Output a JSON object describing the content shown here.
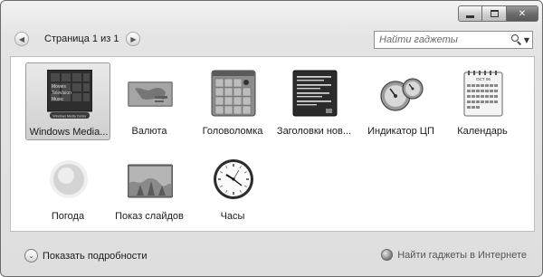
{
  "window": {
    "controls": {
      "minimize": "minimize",
      "maximize": "maximize",
      "close": "✕"
    }
  },
  "pager": {
    "prev": "◀",
    "text": "Страница 1 из 1",
    "next": "▶"
  },
  "search": {
    "placeholder": "Найти гаджеты",
    "dropdown": "▼"
  },
  "gadgets": [
    {
      "label": "Windows Media...",
      "icon": "media-center-icon",
      "selected": true,
      "thumb_lines": [
        "Movies",
        "Television",
        "Music"
      ],
      "thumb_caption": "Windows Media Center"
    },
    {
      "label": "Валюта",
      "icon": "currency-icon"
    },
    {
      "label": "Головоломка",
      "icon": "puzzle-icon"
    },
    {
      "label": "Заголовки нов...",
      "icon": "news-headlines-icon"
    },
    {
      "label": "Индикатор ЦП",
      "icon": "cpu-meter-icon"
    },
    {
      "label": "Календарь",
      "icon": "calendar-icon",
      "thumb_month": "OCT 06"
    },
    {
      "label": "Погода",
      "icon": "weather-icon"
    },
    {
      "label": "Показ слайдов",
      "icon": "slideshow-icon"
    },
    {
      "label": "Часы",
      "icon": "clock-icon"
    }
  ],
  "footer": {
    "details_chevron": "⌄",
    "details_label": "Показать подробности",
    "online_label": "Найти гаджеты в Интернете"
  }
}
